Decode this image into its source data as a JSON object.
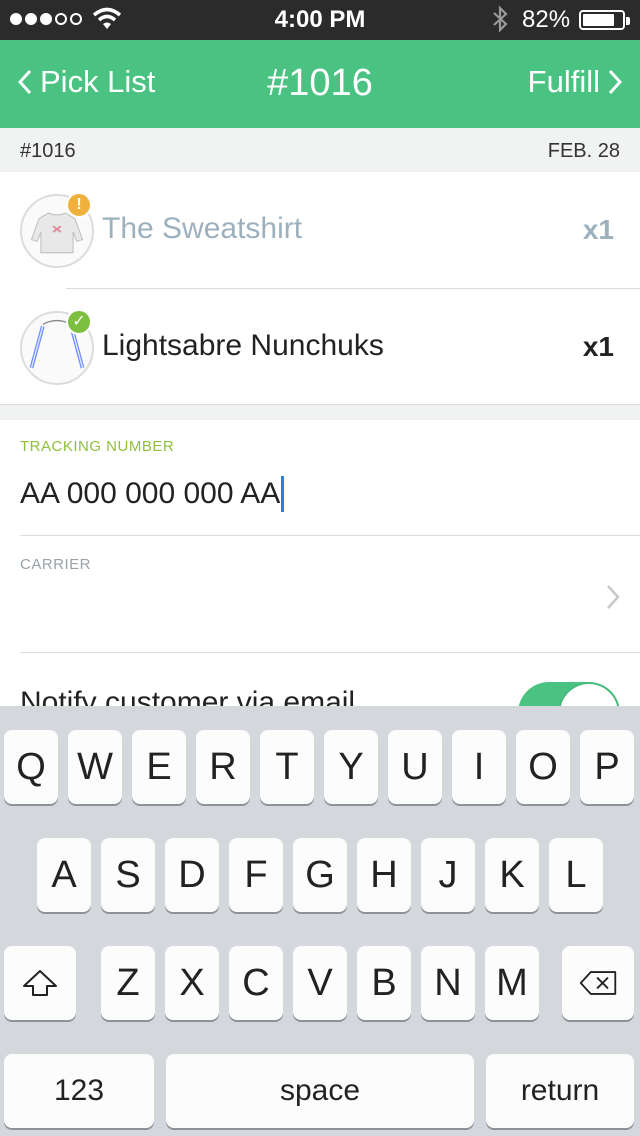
{
  "status_bar": {
    "time": "4:00 PM",
    "battery_percent": "82%",
    "battery_level": 0.82,
    "signal_bars_filled": 3,
    "signal_bars_total": 5,
    "icons": [
      "wifi-icon",
      "bluetooth-icon",
      "battery-icon"
    ]
  },
  "nav": {
    "back_label": "Pick List",
    "title": "#1016",
    "action_label": "Fulfill",
    "color": "#49c282"
  },
  "order": {
    "number": "#1016",
    "date": "FEB. 28"
  },
  "items": [
    {
      "name": "The Sweatshirt",
      "qty": "x1",
      "status": "warning",
      "badge": "!"
    },
    {
      "name": "Lightsabre Nunchuks",
      "qty": "x1",
      "status": "ok",
      "badge": "✓"
    }
  ],
  "form": {
    "tracking_label": "TRACKING NUMBER",
    "tracking_value": "AA 000 000 000 AA",
    "carrier_label": "CARRIER",
    "carrier_value": "",
    "notify_label": "Notify customer via email",
    "notify_enabled": true
  },
  "keyboard": {
    "row1": [
      "Q",
      "W",
      "E",
      "R",
      "T",
      "Y",
      "U",
      "I",
      "O",
      "P"
    ],
    "row2": [
      "A",
      "S",
      "D",
      "F",
      "G",
      "H",
      "J",
      "K",
      "L"
    ],
    "row3": [
      "Z",
      "X",
      "C",
      "V",
      "B",
      "N",
      "M"
    ],
    "numbers_label": "123",
    "space_label": "space",
    "return_label": "return"
  }
}
